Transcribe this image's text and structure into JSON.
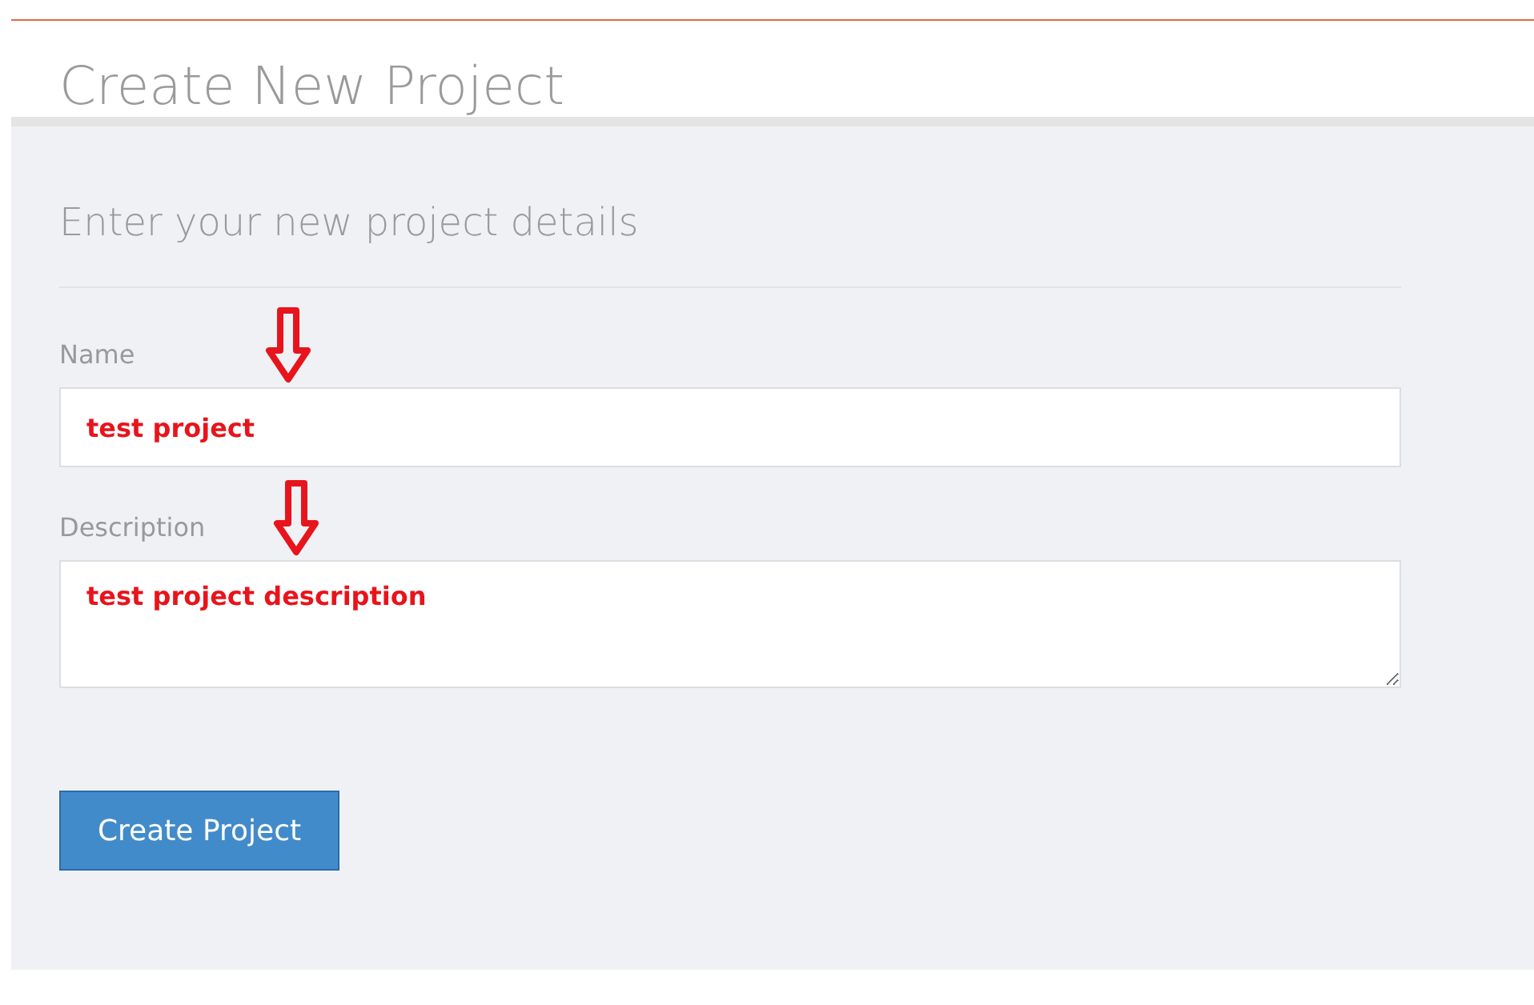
{
  "page_title": "Create New Project",
  "form": {
    "heading": "Enter your new project details",
    "fields": [
      {
        "kind": "text",
        "label": "Name",
        "value": "test project"
      },
      {
        "kind": "textarea",
        "label": "Description",
        "value": "test project description"
      }
    ],
    "submit_button": "Create Project"
  }
}
